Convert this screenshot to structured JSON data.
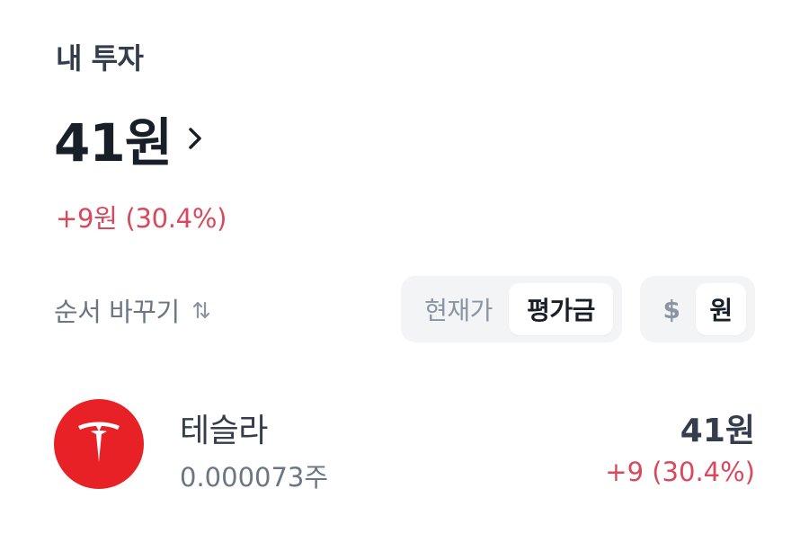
{
  "section": {
    "title": "내 투자"
  },
  "summary": {
    "total": "41원",
    "change": "+9원 (30.4%)"
  },
  "controls": {
    "sort_label": "순서 바꾸기",
    "sort_icon": "sort-arrows-icon",
    "price_toggle": {
      "options": [
        "현재가",
        "평가금"
      ],
      "selected": "평가금"
    },
    "currency_toggle": {
      "options": [
        "$",
        "원"
      ],
      "selected": "원"
    }
  },
  "holdings": [
    {
      "name": "테슬라",
      "quantity": "0.000073주",
      "value": "41원",
      "change": "+9 (30.4%)",
      "logo_icon": "tesla-logo-icon"
    }
  ],
  "colors": {
    "up": "#d9485c",
    "tesla_red": "#e82127",
    "segment_bg": "#f2f4f6",
    "text_primary": "#191f28",
    "text_secondary": "#6b7684"
  }
}
